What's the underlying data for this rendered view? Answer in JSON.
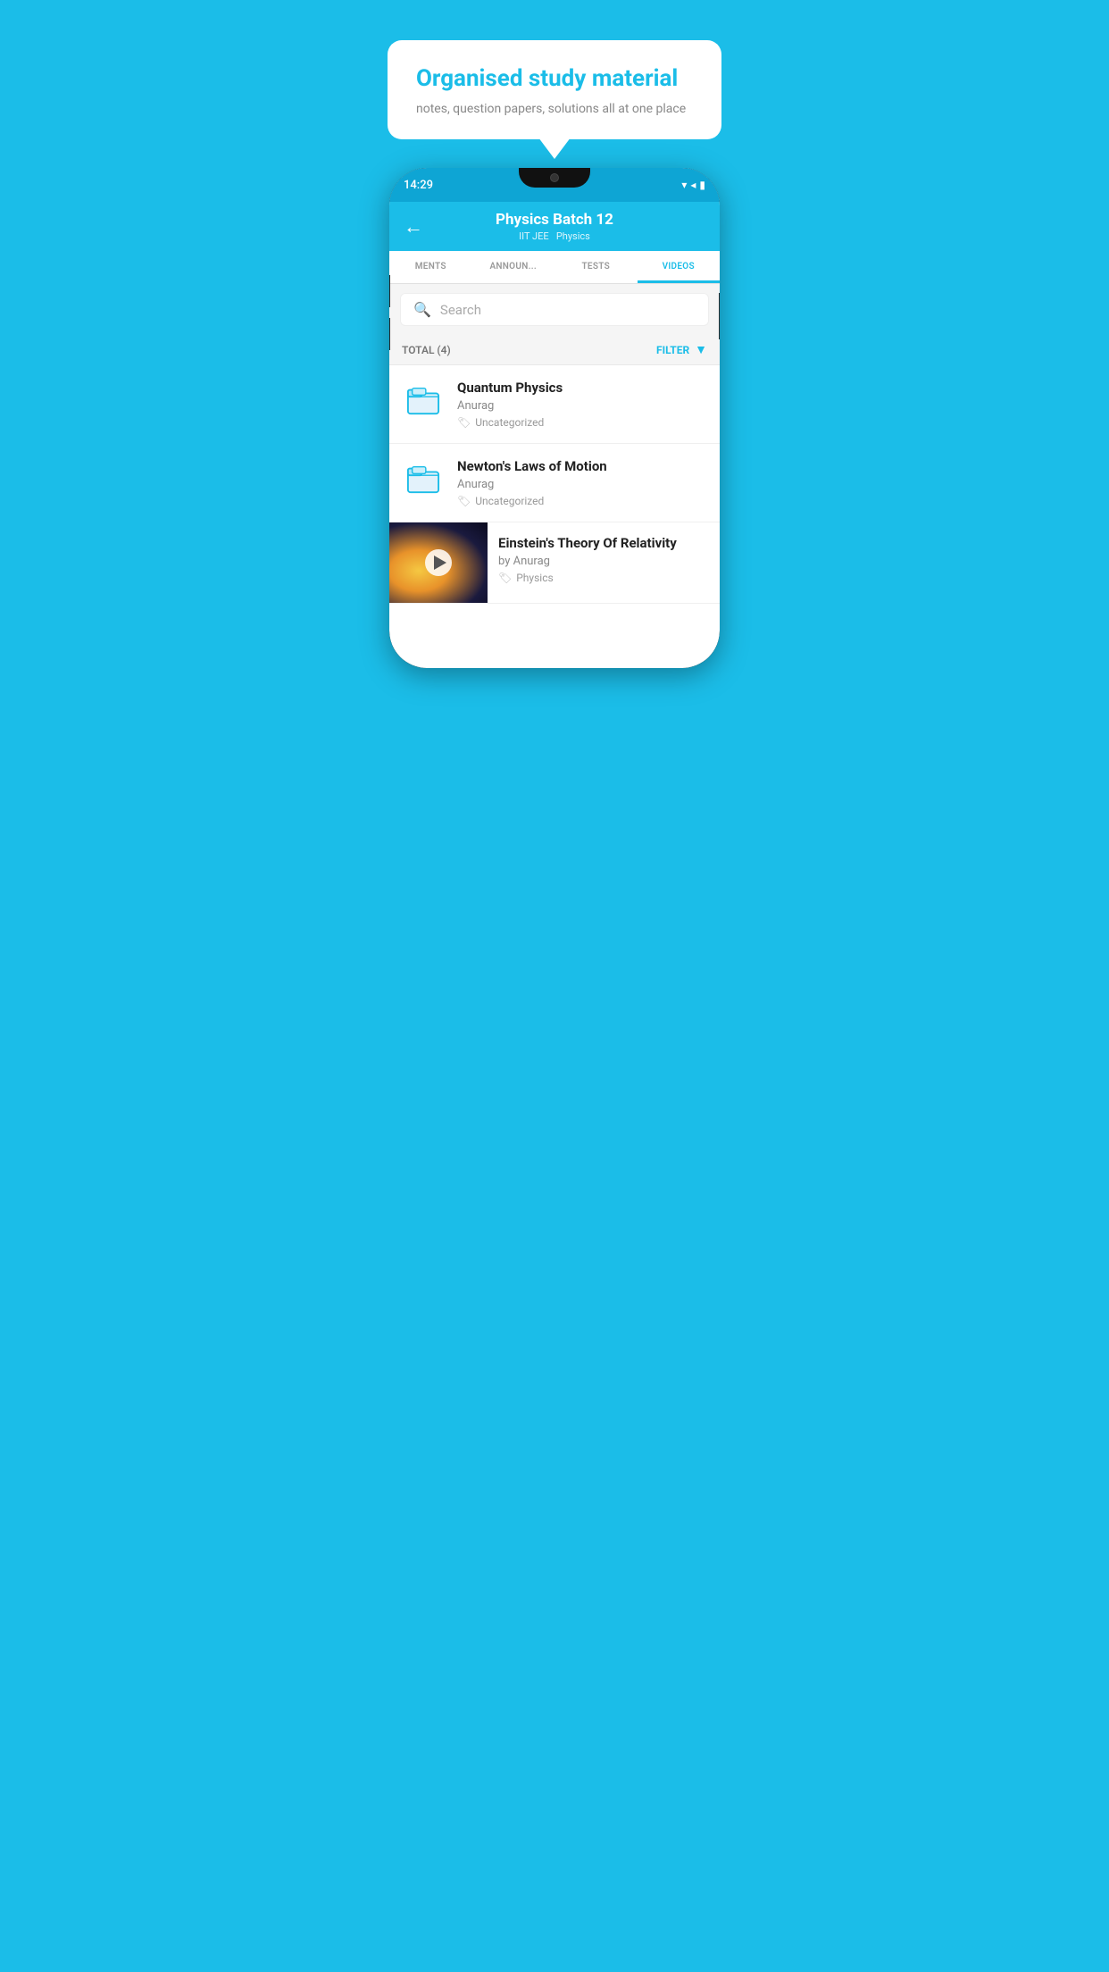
{
  "background_color": "#1bbde8",
  "bubble": {
    "title": "Organised study material",
    "subtitle": "notes, question papers, solutions all at one place"
  },
  "phone": {
    "status_bar": {
      "time": "14:29",
      "icons": [
        "wifi",
        "signal",
        "battery"
      ]
    },
    "header": {
      "title": "Physics Batch 12",
      "subtitle_parts": [
        "IIT JEE",
        "Physics"
      ],
      "back_label": "←"
    },
    "tabs": [
      {
        "label": "MENTS",
        "active": false
      },
      {
        "label": "ANNOUNCEMENTS",
        "active": false
      },
      {
        "label": "TESTS",
        "active": false
      },
      {
        "label": "VIDEOS",
        "active": true
      }
    ],
    "search": {
      "placeholder": "Search"
    },
    "filter_row": {
      "total_label": "TOTAL (4)",
      "filter_label": "FILTER"
    },
    "videos": [
      {
        "id": "quantum-physics",
        "title": "Quantum Physics",
        "author": "Anurag",
        "tag": "Uncategorized",
        "type": "folder"
      },
      {
        "id": "newtons-laws",
        "title": "Newton's Laws of Motion",
        "author": "Anurag",
        "tag": "Uncategorized",
        "type": "folder"
      },
      {
        "id": "einsteins-theory",
        "title": "Einstein's Theory Of Relativity",
        "author": "by Anurag",
        "tag": "Physics",
        "type": "video"
      }
    ]
  }
}
